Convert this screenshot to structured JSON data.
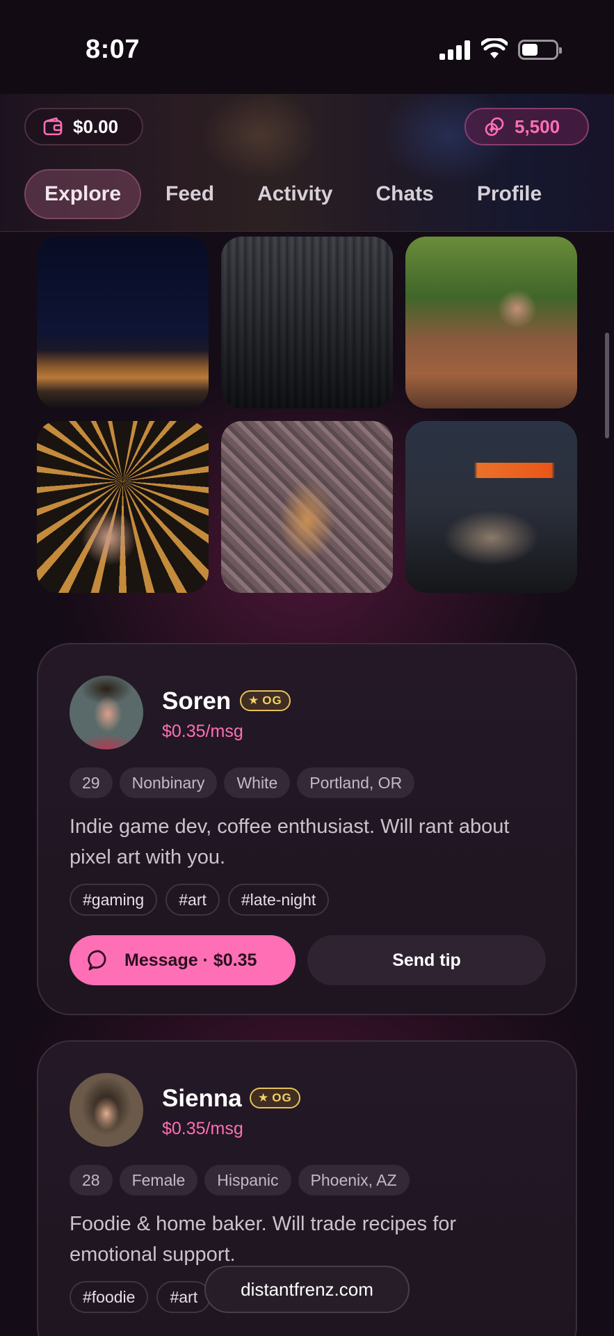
{
  "status_bar": {
    "time": "8:07"
  },
  "header": {
    "wallet_amount": "$0.00",
    "points_amount": "5,500",
    "tabs": [
      {
        "label": "Explore",
        "active": true
      },
      {
        "label": "Feed",
        "active": false
      },
      {
        "label": "Activity",
        "active": false
      },
      {
        "label": "Chats",
        "active": false
      },
      {
        "label": "Profile",
        "active": false
      }
    ]
  },
  "photos": [
    {
      "name": "night-desert-photo"
    },
    {
      "name": "skyscraper-photo"
    },
    {
      "name": "hiker-photo"
    },
    {
      "name": "sombrero-selfie-photo"
    },
    {
      "name": "puppy-photo"
    },
    {
      "name": "sleeping-cat-photo"
    }
  ],
  "profiles": [
    {
      "name": "Soren",
      "badge": "OG",
      "price": "$0.35/msg",
      "chips": [
        "29",
        "Nonbinary",
        "White",
        "Portland, OR"
      ],
      "bio": "Indie game dev, coffee enthusiast. Will rant about pixel art with you.",
      "tags": [
        "#gaming",
        "#art",
        "#late-night"
      ],
      "message_label": "Message · $0.35",
      "tip_label": "Send tip"
    },
    {
      "name": "Sienna",
      "badge": "OG",
      "price": "$0.35/msg",
      "chips": [
        "28",
        "Female",
        "Hispanic",
        "Phoenix, AZ"
      ],
      "bio": "Foodie & home baker. Will trade recipes for emotional support.",
      "tags": [
        "#foodie",
        "#art"
      ]
    }
  ],
  "url_bar": {
    "domain": "distantfrenz.com"
  },
  "colors": {
    "accent": "#ff6fb5",
    "badge_gold": "#e8c15a",
    "background": "#140c16"
  }
}
